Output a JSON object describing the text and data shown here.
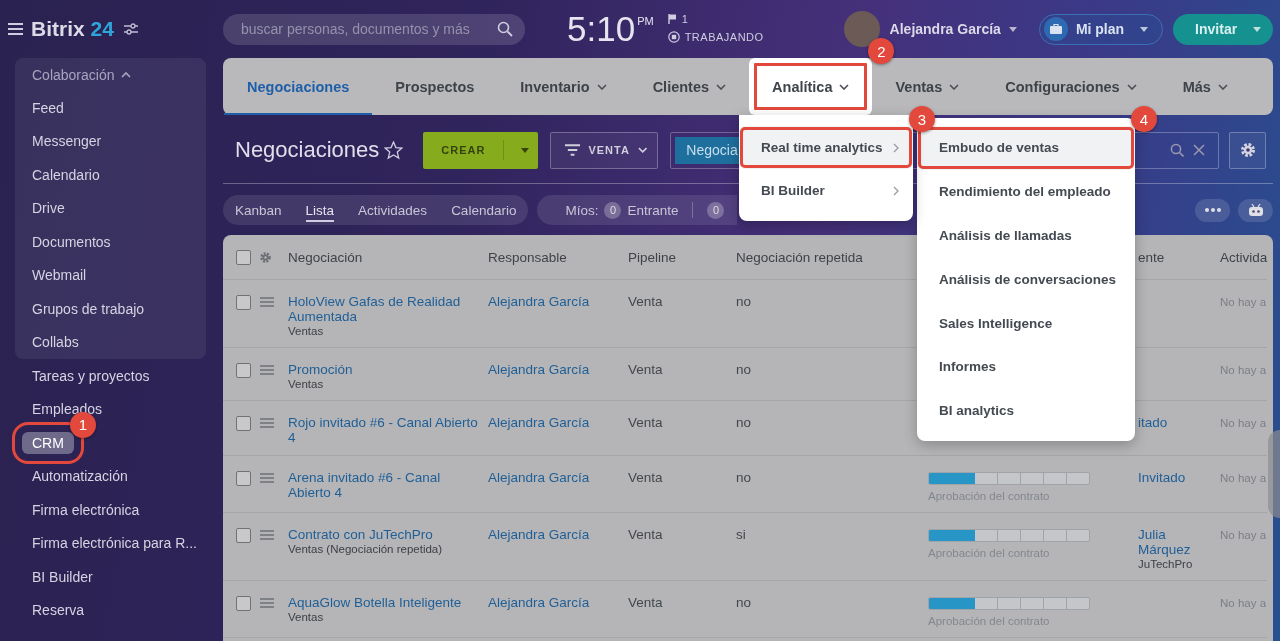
{
  "sidebar": {
    "logo": {
      "name": "Bitrix",
      "number": "24"
    },
    "group": {
      "title": "Colaboración",
      "expanded": true,
      "items": [
        {
          "label": "Feed",
          "selected": false
        },
        {
          "label": "Messenger",
          "selected": false
        },
        {
          "label": "Calendario",
          "selected": false
        },
        {
          "label": "Drive",
          "selected": false
        },
        {
          "label": "Documentos",
          "selected": false
        },
        {
          "label": "Webmail",
          "selected": false
        },
        {
          "label": "Grupos de trabajo",
          "selected": false
        },
        {
          "label": "Collabs",
          "selected": false
        }
      ]
    },
    "items": [
      {
        "label": "Tareas y proyectos",
        "selected": false
      },
      {
        "label": "Empleados",
        "selected": false
      },
      {
        "label": "CRM",
        "selected": true,
        "callout": "1"
      },
      {
        "label": "Automatización",
        "selected": false
      },
      {
        "label": "Firma electrónica",
        "selected": false
      },
      {
        "label": "Firma electrónica para R...",
        "selected": false
      },
      {
        "label": "BI Builder",
        "selected": false
      },
      {
        "label": "Reserva",
        "selected": false
      }
    ]
  },
  "topbar": {
    "search": {
      "placeholder": "buscar personas, documentos y más"
    },
    "clock": {
      "time": "5:10",
      "period": "PM",
      "flag_count": "1",
      "status": "TRABAJANDO"
    },
    "user": {
      "name": "Alejandra García"
    },
    "plan_button": "Mi plan",
    "invite_button": "Invitar"
  },
  "tabs": [
    {
      "label": "Negociaciones",
      "selected": true,
      "dropdown": false,
      "open": false
    },
    {
      "label": "Prospectos",
      "selected": false,
      "dropdown": false,
      "open": false
    },
    {
      "label": "Inventario",
      "selected": false,
      "dropdown": true,
      "open": false
    },
    {
      "label": "Clientes",
      "selected": false,
      "dropdown": true,
      "open": false
    },
    {
      "label": "Analítica",
      "selected": false,
      "dropdown": true,
      "open": true,
      "callout": "2"
    },
    {
      "label": "Ventas",
      "selected": false,
      "dropdown": true,
      "open": false
    },
    {
      "label": "Configuraciones",
      "selected": false,
      "dropdown": true,
      "open": false
    },
    {
      "label": "Más",
      "selected": false,
      "dropdown": true,
      "open": false
    }
  ],
  "analytics_menu": {
    "items": [
      {
        "label": "Real time analytics",
        "selected": true,
        "submenu": true,
        "callout": "3"
      },
      {
        "label": "BI Builder",
        "selected": false,
        "submenu": true
      }
    ]
  },
  "analytics_submenu": {
    "items": [
      {
        "label": "Embudo de ventas",
        "selected": true,
        "callout": "4"
      },
      {
        "label": "Rendimiento del empleado",
        "selected": false
      },
      {
        "label": "Análisis de llamadas",
        "selected": false
      },
      {
        "label": "Análisis de conversaciones",
        "selected": false
      },
      {
        "label": "Sales Intelligence",
        "selected": false
      },
      {
        "label": "Informes",
        "selected": false
      },
      {
        "label": "BI analytics",
        "selected": false
      }
    ]
  },
  "toolbar": {
    "title": "Negociaciones",
    "create_button": "CREAR",
    "filter_button": "VENTA",
    "filter_chip": "Negocia"
  },
  "views": [
    {
      "label": "Kanban",
      "selected": false
    },
    {
      "label": "Lista",
      "selected": true
    },
    {
      "label": "Actividades",
      "selected": false
    },
    {
      "label": "Calendario",
      "selected": false
    }
  ],
  "counters": {
    "label": "Míos:",
    "items": [
      {
        "count": "0",
        "label": "Entrante"
      },
      {
        "count": "0"
      }
    ]
  },
  "table": {
    "header_checked": false,
    "columns": [
      "Negociación",
      "Responsable",
      "Pipeline",
      "Negociación repetida",
      "ente",
      "Activida"
    ],
    "rows": [
      {
        "checked": false,
        "title": "HoloView Gafas de Realidad Aumentada",
        "subtitle": "Ventas",
        "responsible": "Alejandra García",
        "pipeline": "Venta",
        "repeated": "no",
        "activity": "No hay a"
      },
      {
        "checked": false,
        "title": "Promoción",
        "subtitle": "Ventas",
        "responsible": "Alejandra García",
        "pipeline": "Venta",
        "repeated": "no",
        "activity": "No hay a"
      },
      {
        "checked": false,
        "title": "Rojo invitado #6 - Canal Abierto 4",
        "responsible": "Alejandra García",
        "pipeline": "Venta",
        "repeated": "no",
        "client": {
          "name": "itado"
        },
        "activity": "No hay a"
      },
      {
        "checked": false,
        "title": "Arena invitado #6 - Canal Abierto 4",
        "responsible": "Alejandra García",
        "pipeline": "Venta",
        "repeated": "no",
        "stage": {
          "level": 0.286,
          "label": "Aprobación del contrato"
        },
        "client": {
          "name": "Invitado"
        },
        "activity": "No hay a"
      },
      {
        "checked": false,
        "title": "Contrato con JuTechPro",
        "subtitle": "Ventas (Negociación repetida)",
        "responsible": "Alejandra García",
        "pipeline": "Venta",
        "repeated": "si",
        "stage": {
          "level": 0.286,
          "label": "Aprobación del contrato"
        },
        "client": {
          "name": "Julia Márquez",
          "company": "JuTechPro"
        },
        "activity": "No hay a"
      },
      {
        "checked": false,
        "title": "AquaGlow Botella Inteligente",
        "subtitle": "Ventas",
        "responsible": "Alejandra García",
        "pipeline": "Venta",
        "repeated": "no",
        "stage": {
          "level": 0.286,
          "label": "Aprobación del contrato"
        },
        "activity": "No hay a"
      }
    ]
  }
}
